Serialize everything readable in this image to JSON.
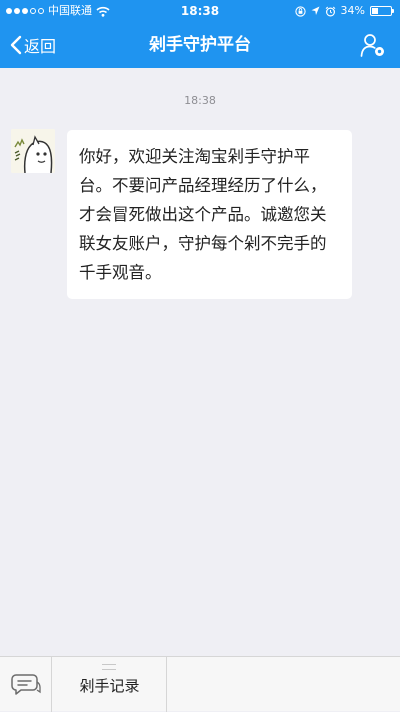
{
  "status_bar": {
    "carrier": "中国联通",
    "time": "18:38",
    "battery_percent": "34%",
    "battery_level": 0.34,
    "icons": [
      "signal-dots-icon",
      "wifi-icon",
      "lock-rotation-icon",
      "location-icon",
      "alarm-icon",
      "battery-icon"
    ]
  },
  "nav": {
    "back_label": "返回",
    "title": "剁手守护平台",
    "right_icon": "user-settings-icon"
  },
  "chat": {
    "timestamp": "18:38",
    "message": "你好，欢迎关注淘宝剁手守护平台。不要问产品经理经历了什么，才会冒死做出这个产品。诚邀您关联女友账户，守护每个剁不完手的千手观音。"
  },
  "bottom_bar": {
    "left_icon": "chat-keyboard-toggle-icon",
    "menu_label": "剁手记录"
  },
  "colors": {
    "header_bg": "#1f94f0",
    "page_bg": "#efeff4",
    "bubble_bg": "#ffffff"
  }
}
